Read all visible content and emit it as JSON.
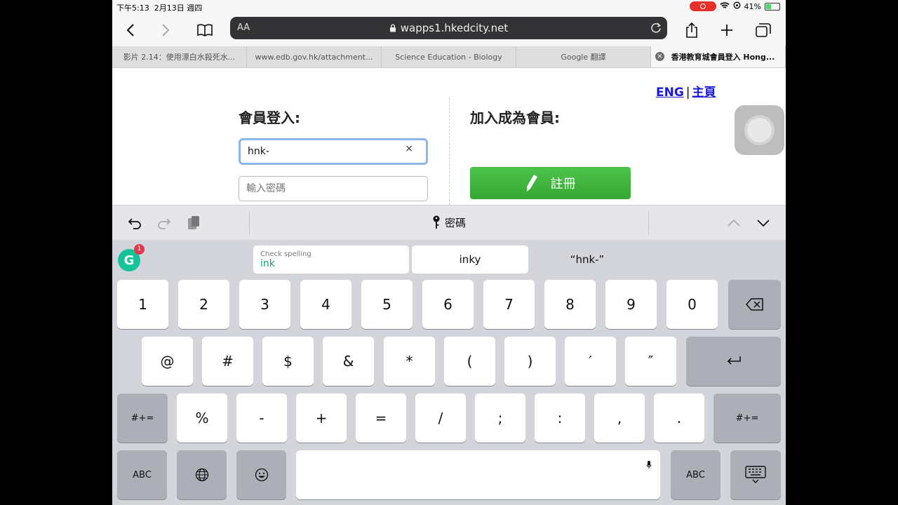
{
  "status_bar": {
    "time": "下午5:13",
    "date": "2月13日 週四",
    "battery": "41%",
    "battery_level": 0.41
  },
  "toolbar": {
    "text_size_label": "AA",
    "url": "wapps1.hkedcity.net"
  },
  "tabs": [
    {
      "title": "影片 2.14：使用漂白水殺死水...",
      "active": false
    },
    {
      "title": "www.edb.gov.hk/attachment...",
      "active": false
    },
    {
      "title": "Science Education - Biology",
      "active": false
    },
    {
      "title": "Google 翻譯",
      "active": false
    },
    {
      "title": "香港教育城會員登入 Hong...",
      "active": true
    }
  ],
  "page": {
    "lang_link": "ENG",
    "separator": "|",
    "home_link": "主頁",
    "login_heading": "會員登入:",
    "join_heading": "加入成為會員:",
    "username_value": "hnk-",
    "clear_glyph": "×",
    "password_placeholder": "輸入密碼",
    "register_label": "註冊"
  },
  "accessory_bar": {
    "field_label": "密碼"
  },
  "suggestions": {
    "grammarly_badge": "1",
    "grammarly_letter": "G",
    "check_label": "Check spelling",
    "check_word": "ink",
    "option_2": "inky",
    "option_3": "“hnk-”"
  },
  "keyboard": {
    "row1": [
      "1",
      "2",
      "3",
      "4",
      "5",
      "6",
      "7",
      "8",
      "9",
      "0"
    ],
    "row2": [
      "@",
      "#",
      "$",
      "&",
      "*",
      "(",
      ")",
      "′",
      "″"
    ],
    "row3": [
      "%",
      "-",
      "+",
      "=",
      "/",
      ";",
      ":",
      ",",
      "."
    ],
    "symbols_toggle": "#+=",
    "abc_label": "ABC"
  },
  "colors": {
    "accent_green": "#3cb33a",
    "link_blue": "#1a1ad6",
    "grammarly": "#15c39a"
  }
}
